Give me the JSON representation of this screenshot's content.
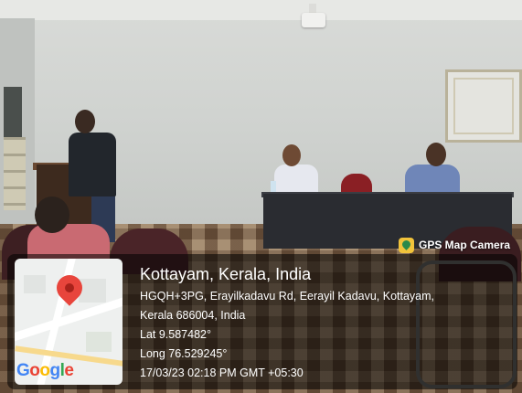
{
  "badge": {
    "label": "GPS Map Camera",
    "icon": "gps-map-camera-app-icon",
    "color": "#f1c33b"
  },
  "location": {
    "title": "Kottayam, Kerala, India",
    "address_line1": "HGQH+3PG, Erayilkadavu Rd, Eerayil Kadavu, Kottayam,",
    "address_line2": "Kerala 686004, India",
    "lat": "Lat 9.587482°",
    "long": "Long 76.529245°",
    "datetime": "17/03/23 02:18 PM GMT +05:30"
  },
  "map": {
    "pin_icon": "location-pin-icon",
    "pin_color": "#e8453c",
    "logo_text": [
      "G",
      "o",
      "o",
      "g",
      "l",
      "e"
    ]
  }
}
